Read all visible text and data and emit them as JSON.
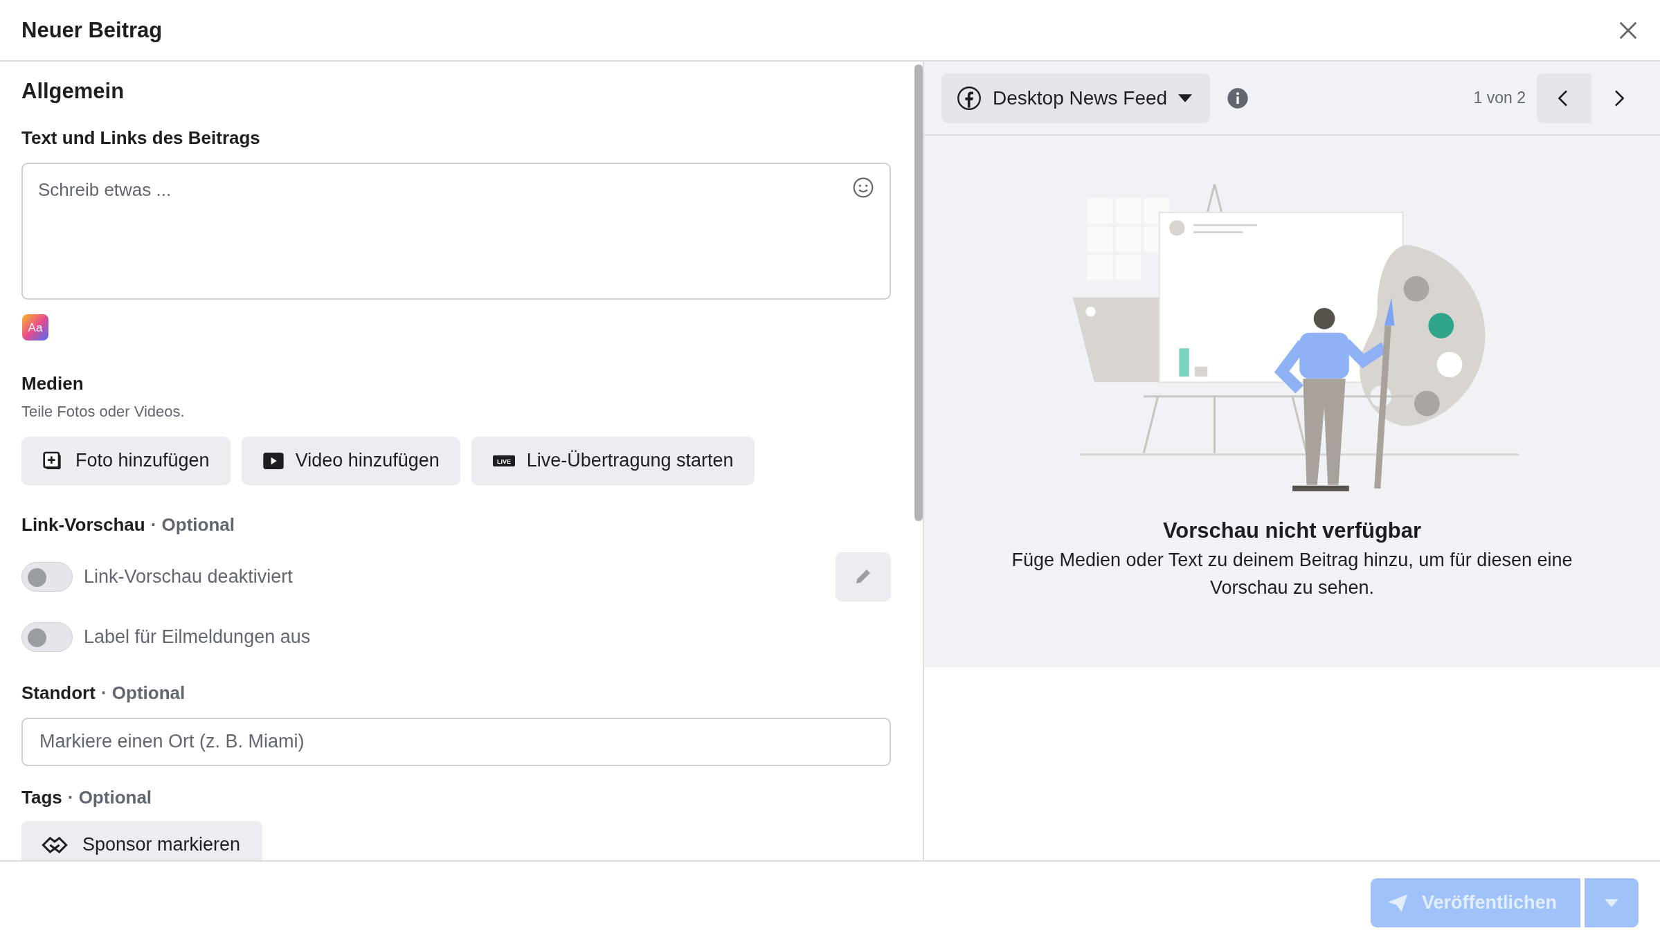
{
  "window": {
    "title": "Neuer Beitrag"
  },
  "editor": {
    "heading": "Allgemein",
    "text_label": "Text und Links des Beitrags",
    "text_field": {
      "placeholder": "Schreib etwas ..."
    },
    "format_icon_text": "Aa",
    "media": {
      "title": "Medien",
      "subtitle": "Teile Fotos oder Videos.",
      "buttons": [
        {
          "kind": "photo",
          "label": "Foto hinzufügen"
        },
        {
          "kind": "video",
          "label": "Video hinzufügen"
        },
        {
          "kind": "live",
          "label": "Live-Übertragung starten",
          "icon_text": "LIVE"
        }
      ]
    },
    "link_preview": {
      "title": "Link-Vorschau",
      "optional": "· Optional",
      "toggles": [
        {
          "label": "Link-Vorschau deaktiviert",
          "on": false
        },
        {
          "label": "Label für Eilmeldungen aus",
          "on": false
        }
      ]
    },
    "location": {
      "title": "Standort",
      "optional": "· Optional",
      "placeholder": "Markiere einen Ort (z. B. Miami)"
    },
    "tags": {
      "title": "Tags",
      "optional": "· Optional",
      "button": "Sponsor markieren"
    }
  },
  "preview": {
    "placement": "Desktop News Feed",
    "pager": "1 von 2",
    "heading": "Vorschau nicht verfügbar",
    "text": "Füge Medien oder Text zu deinem Beitrag hinzu, um für diesen eine Vorschau zu sehen."
  },
  "footer": {
    "publish": {
      "label": "Veröffentlichen",
      "disabled": true
    }
  }
}
